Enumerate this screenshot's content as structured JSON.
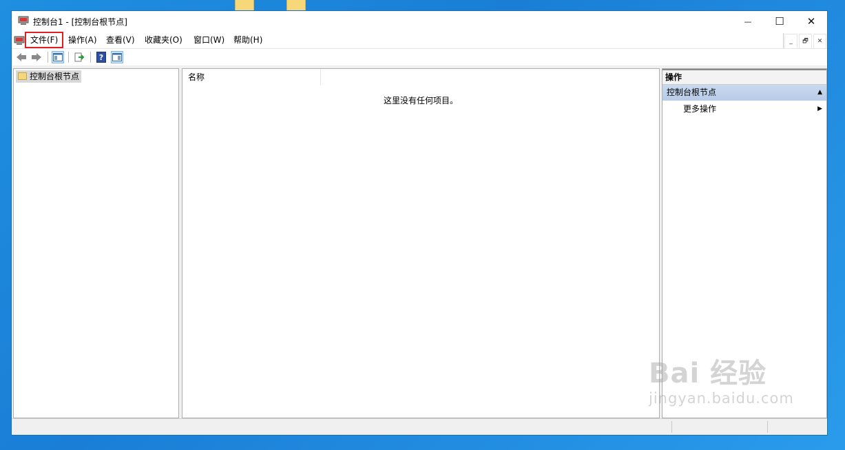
{
  "window": {
    "title": "控制台1 - [控制台根节点]",
    "controls": {
      "minimize": "—",
      "maximize": "☐",
      "close": "✕"
    }
  },
  "menubar": {
    "items": [
      {
        "label": "文件(F)",
        "highlighted": true
      },
      {
        "label": "操作(A)"
      },
      {
        "label": "查看(V)"
      },
      {
        "label": "收藏夹(O)"
      },
      {
        "label": "窗口(W)"
      },
      {
        "label": "帮助(H)"
      }
    ],
    "mdi_controls": {
      "minimize": "_",
      "restore": "🗗",
      "close": "✕"
    }
  },
  "toolbar": {
    "icons": [
      "back-arrow-icon",
      "forward-arrow-icon",
      "show-hide-tree-icon",
      "export-list-icon",
      "help-icon",
      "show-hide-action-pane-icon"
    ]
  },
  "tree": {
    "root_label": "控制台根节点"
  },
  "list": {
    "column_name": "名称",
    "empty_message": "这里没有任何项目。"
  },
  "actions": {
    "title": "操作",
    "node_label": "控制台根节点",
    "more_label": "更多操作"
  },
  "watermark": {
    "line1": "Bai 经验",
    "line2": "jingyan.baidu.com"
  },
  "colors": {
    "desktop": "#1a7ed6",
    "highlight_box": "#e02020",
    "actions_node_bg": "#c9daf0"
  }
}
